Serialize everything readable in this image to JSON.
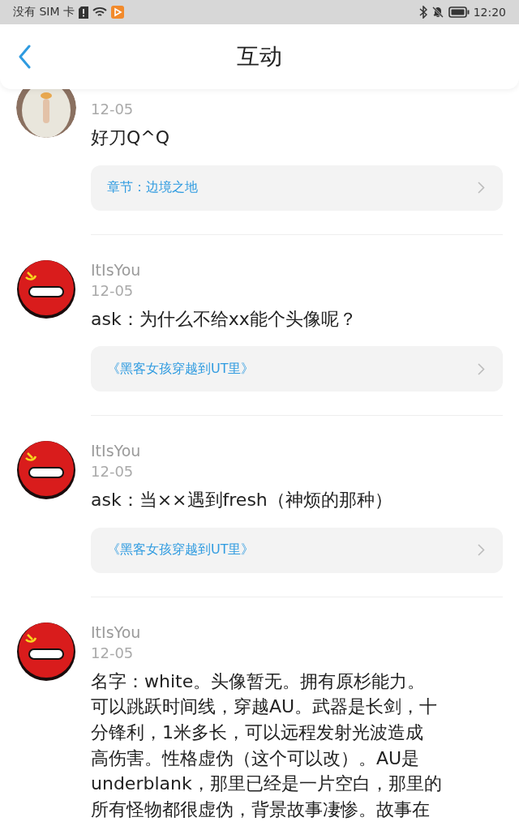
{
  "status_bar": {
    "carrier": "没有 SIM 卡",
    "time": "12:20"
  },
  "header": {
    "title": "互动"
  },
  "comments": [
    {
      "kind": "picture",
      "date": "12-05",
      "lines": [
        "好刀Q^Q"
      ],
      "link": "章节：边境之地"
    },
    {
      "kind": "drawing",
      "name": "ItIsYou",
      "date": "12-05",
      "lines": [
        "ask：为什么不给xx能个头像呢？"
      ],
      "link": "《黑客女孩穿越到UT里》"
    },
    {
      "kind": "drawing",
      "name": "ItIsYou",
      "date": "12-05",
      "lines": [
        "ask：当××遇到fresh（神烦的那种）"
      ],
      "link": "《黑客女孩穿越到UT里》"
    },
    {
      "kind": "drawing",
      "name": "ItIsYou",
      "date": "12-05",
      "lines": [
        "名字：white。头像暂无。拥有原杉能力。",
        "可以跳跃时间线，穿越AU。武器是长剑，十",
        "分锋利，1米多长，可以远程发射光波造成",
        "高伤害。性格虚伪（这个可以改）。AU是",
        "underblank，那里已经是一片空白，那里的",
        "所有怪物都很虚伪，背景故事凄惨。故事在"
      ]
    }
  ]
}
